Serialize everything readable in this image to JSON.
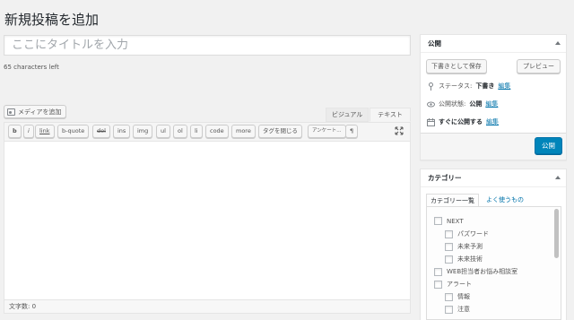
{
  "page": {
    "title": "新規投稿を追加"
  },
  "post_title": {
    "placeholder": "ここにタイトルを入力",
    "value": ""
  },
  "chars_left": "65 characters left",
  "media_button": "メディアを追加",
  "editor_tabs": {
    "visual": "ビジュアル",
    "text": "テキスト"
  },
  "quicktags": [
    "b",
    "i",
    "link",
    "b-quote",
    "del",
    "ins",
    "img",
    "ul",
    "ol",
    "li",
    "code",
    "more",
    "タグを閉じる",
    "アンケート...",
    "¶"
  ],
  "status_bar": "文字数: 0",
  "publish": {
    "heading": "公開",
    "save_draft": "下書きとして保存",
    "preview": "プレビュー",
    "status_label": "ステータス:",
    "status_value": "下書き",
    "visibility_label": "公開状態:",
    "visibility_value": "公開",
    "schedule_label": "すぐに公開する",
    "edit": "編集",
    "publish_button": "公開"
  },
  "categories": {
    "heading": "カテゴリー",
    "tab_all": "カテゴリー一覧",
    "tab_popular": "よく使うもの",
    "items": [
      {
        "label": "NEXT",
        "level": 0
      },
      {
        "label": "パズワード",
        "level": 1
      },
      {
        "label": "未来予測",
        "level": 1
      },
      {
        "label": "未来技術",
        "level": 1
      },
      {
        "label": "WEB担当者お悩み相談室",
        "level": 0
      },
      {
        "label": "アラート",
        "level": 0
      },
      {
        "label": "情報",
        "level": 1
      },
      {
        "label": "注意",
        "level": 1
      }
    ]
  },
  "colors": {
    "accent": "#0085ba",
    "link": "#0073aa",
    "background": "#f1f1f1"
  },
  "icons": {
    "status": "pin-icon",
    "visibility": "eye-icon",
    "schedule": "calendar-icon",
    "media": "media-icon",
    "fullscreen": "fullscreen-icon"
  }
}
